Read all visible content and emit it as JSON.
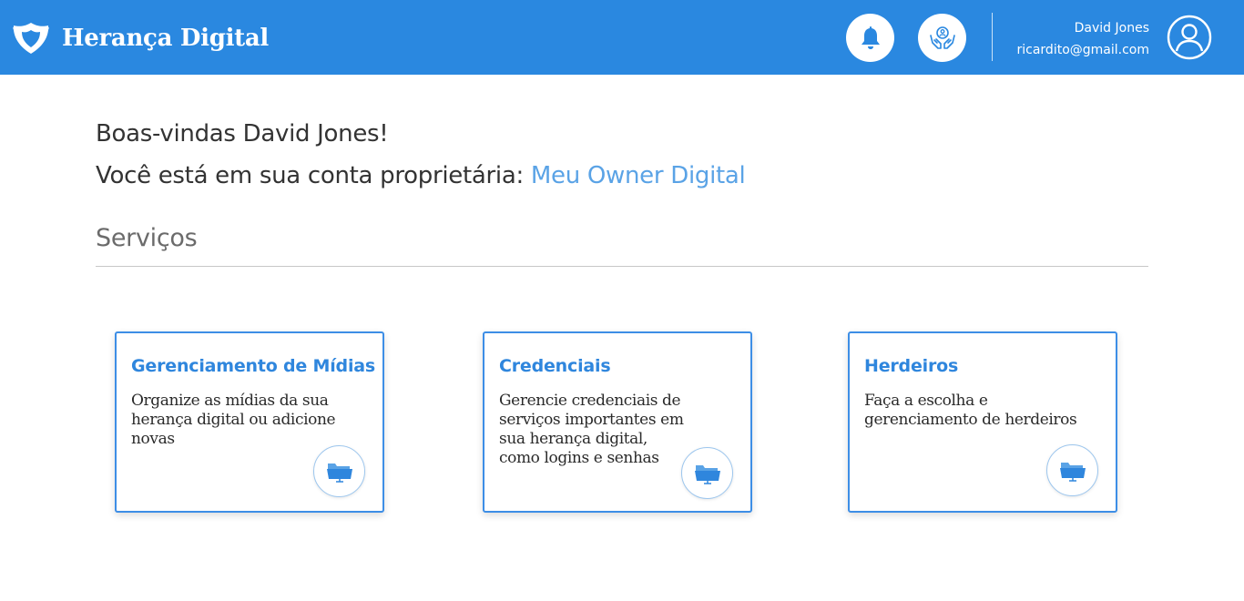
{
  "app": {
    "name": "Herança Digital"
  },
  "header": {
    "notifications_icon": "bell-icon",
    "heirs_icon": "hands-heart-icon",
    "user": {
      "name": "David Jones",
      "email": "ricardito@gmail.com",
      "avatar_icon": "user-circle-icon"
    }
  },
  "main": {
    "welcome": "Boas-vindas David Jones!",
    "account_prefix": "Você está em sua conta proprietária: ",
    "account_link": "Meu Owner Digital",
    "section_title": "Serviços",
    "services": [
      {
        "title": "Gerenciamento de Mídias",
        "description": "Organize as mídias da sua herança digital ou adicione novas",
        "icon": "folder-icon"
      },
      {
        "title": "Credenciais",
        "description": "Gerencie credenciais de serviços importantes em sua herança digital, como logins e senhas",
        "icon": "folder-icon"
      },
      {
        "title": "Herdeiros",
        "description": "Faça a escolha e gerenciamento de herdeiros",
        "icon": "folder-icon"
      }
    ]
  },
  "colors": {
    "header_bg": "#2a88e0",
    "accent": "#2f86dd",
    "link": "#5aa3e6",
    "card_border": "#3d8ee6"
  }
}
